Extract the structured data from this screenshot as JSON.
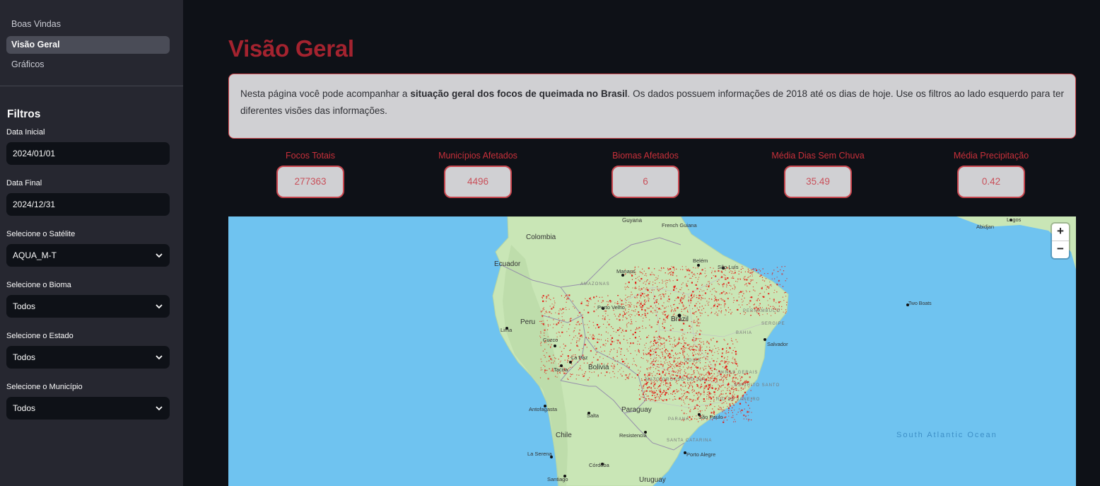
{
  "sidebar": {
    "nav": [
      {
        "label": "Boas Vindas",
        "active": false
      },
      {
        "label": "Visão Geral",
        "active": true
      },
      {
        "label": "Gráficos",
        "active": false
      }
    ],
    "filters_title": "Filtros",
    "filters": {
      "start_date": {
        "label": "Data Inicial",
        "value": "2024/01/01"
      },
      "end_date": {
        "label": "Data Final",
        "value": "2024/12/31"
      },
      "satellite": {
        "label": "Selecione o Satélite",
        "value": "AQUA_M-T"
      },
      "biome": {
        "label": "Selecione o Bioma",
        "value": "Todos"
      },
      "state": {
        "label": "Selecione o Estado",
        "value": "Todos"
      },
      "municipality": {
        "label": "Selecione o Município",
        "value": "Todos"
      }
    }
  },
  "main": {
    "title": "Visão Geral",
    "intro": {
      "before": "Nesta página você pode acompanhar a ",
      "bold": "situação geral dos focos de queimada no Brasil",
      "after": ". Os dados possuem informações de 2018 até os dias de hoje. Use os filtros ao lado esquerdo para ter diferentes visões das informações."
    },
    "metrics": [
      {
        "label": "Focos Totais",
        "value": "277363"
      },
      {
        "label": "Municípios Afetados",
        "value": "4496"
      },
      {
        "label": "Biomas Afetados",
        "value": "6"
      },
      {
        "label": "Média Dias Sem Chuva",
        "value": "35.49"
      },
      {
        "label": "Média Precipitação",
        "value": "0.42"
      }
    ]
  },
  "map": {
    "zoom_in": "+",
    "zoom_out": "−",
    "labels": {
      "colombia": "Colombia",
      "guyana": "Guyana",
      "french_guiana": "French\nGuiana",
      "ecuador": "Ecuador",
      "peru": "Peru",
      "bolivia": "Bolivia",
      "brazil": "Brazil",
      "paraguay": "Paraguay",
      "chile": "Chile",
      "uruguay": "Uruguay",
      "manaus": "Manaus",
      "belem": "Belém",
      "sao_luis": "São Luís",
      "porto_velho": "Porto Velho",
      "lima": "Lima",
      "cuzco": "Cuzco",
      "la_paz": "La Paz",
      "tacna": "Tacna",
      "antofagasta": "Antofagasta",
      "salta": "Salta",
      "resistencia": "Resistencia",
      "la_serena": "La Serena",
      "cordoba": "Córdoba",
      "santiago": "Santiago",
      "salvador": "Salvador",
      "sao_paulo": "São Paulo",
      "porto_alegre": "Porto Alegre",
      "lagos": "Lagos",
      "abidjan": "Abidjan",
      "two_boats": "Two Boats",
      "amazonas": "AMAZONAS",
      "bahia": "BAHIA",
      "pernambuco": "PERNAMBUCO",
      "sergipe": "SERGIPE",
      "goias": "GOIÁS",
      "parana": "PARANÁ",
      "santa_catarina": "SANTA CATARINA",
      "mato_grosso": "MATO GROSSO DO SUL",
      "minas": "MINAS GERAIS",
      "espirito": "ESPÍRITO SANTO",
      "rio": "RIO DE JANEIRO",
      "south_atlantic": "South Atlantic Ocean"
    },
    "colors": {
      "ocean": "#6fc3f0",
      "land": "#c9e6b6",
      "fire": "#e3170f",
      "border": "#8a7aa8"
    }
  }
}
